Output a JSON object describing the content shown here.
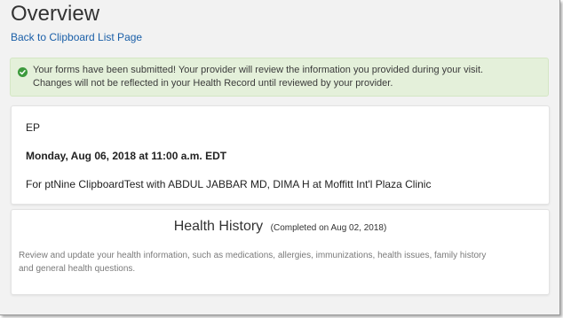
{
  "page": {
    "title": "Overview",
    "back_link": "Back to Clipboard List Page"
  },
  "alert": {
    "line1": "Your forms have been submitted! Your provider will review the information you provided during your visit.",
    "line2": "Changes will not be reflected in your Health Record until reviewed by your provider."
  },
  "appointment": {
    "type": "EP",
    "datetime": "Monday, Aug 06, 2018 at 11:00 a.m. EDT",
    "details": "For ptNine ClipboardTest with ABDUL JABBAR MD, DIMA H at Moffitt Int'l Plaza Clinic"
  },
  "health_history": {
    "title": "Health History",
    "completed": "(Completed on Aug 02, 2018)",
    "description_line1": "Review and update your health information, such as medications, allergies, immunizations, health issues, family history",
    "description_line2": "and general health questions."
  },
  "colors": {
    "link": "#1a5fa8",
    "alert_bg": "#e4f0da",
    "success_icon": "#3c9a3c"
  }
}
